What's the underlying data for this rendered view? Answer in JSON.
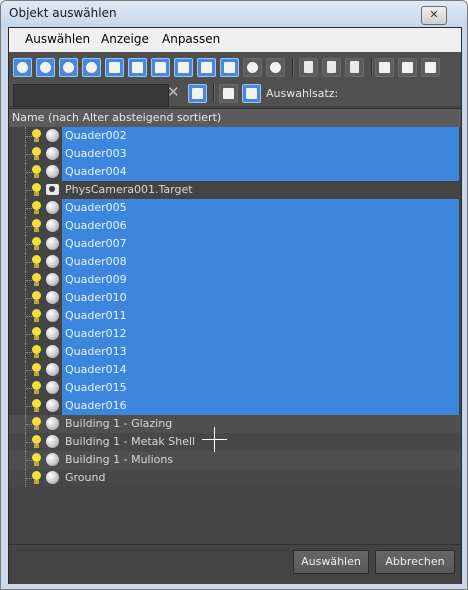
{
  "window": {
    "title": "Objekt auswählen",
    "close_glyph": "✕"
  },
  "menu": [
    "Auswählen",
    "Anzeige",
    "Anpassen"
  ],
  "toolbar": {
    "buttons": [
      {
        "name": "geometry-icon",
        "on": true,
        "shape": "circle"
      },
      {
        "name": "shapes-icon",
        "on": true,
        "shape": "circle"
      },
      {
        "name": "lights-icon",
        "on": true,
        "shape": "circle"
      },
      {
        "name": "cameras-icon",
        "on": true,
        "shape": "circle"
      },
      {
        "name": "helpers-icon",
        "on": true,
        "shape": "sq"
      },
      {
        "name": "space-warps-icon",
        "on": true,
        "shape": "sq"
      },
      {
        "name": "groups-icon",
        "on": true,
        "shape": "sq"
      },
      {
        "name": "xrefs-icon",
        "on": true,
        "shape": "sq"
      },
      {
        "name": "bones-icon",
        "on": true,
        "shape": "sq"
      },
      {
        "name": "containers-icon",
        "on": true,
        "shape": "sq"
      },
      {
        "name": "frozen-objects-icon",
        "on": false,
        "shape": "circle"
      },
      {
        "name": "hidden-objects-icon",
        "on": false,
        "shape": "circle"
      },
      {
        "name": "select-all-icon",
        "on": false,
        "shape": "doc"
      },
      {
        "name": "select-none-icon",
        "on": false,
        "shape": "doc"
      },
      {
        "name": "select-invert-icon",
        "on": false,
        "shape": "doc"
      },
      {
        "name": "filter-icon",
        "on": false,
        "shape": "sq"
      },
      {
        "name": "filter-list-icon",
        "on": false,
        "shape": "sq"
      },
      {
        "name": "display-options-icon",
        "on": false,
        "shape": "sq"
      }
    ],
    "search_value": "",
    "clear_glyph": "✕",
    "selection_set_label": "Auswahlsatz:"
  },
  "list": {
    "header": "Name (nach Alter absteigend sortiert)",
    "items": [
      {
        "name": "Quader002",
        "selected": true,
        "type": "geometry"
      },
      {
        "name": "Quader003",
        "selected": true,
        "type": "geometry"
      },
      {
        "name": "Quader004",
        "selected": true,
        "type": "geometry"
      },
      {
        "name": "PhysCamera001.Target",
        "selected": false,
        "type": "camera"
      },
      {
        "name": "Quader005",
        "selected": true,
        "type": "geometry"
      },
      {
        "name": "Quader006",
        "selected": true,
        "type": "geometry"
      },
      {
        "name": "Quader007",
        "selected": true,
        "type": "geometry"
      },
      {
        "name": "Quader008",
        "selected": true,
        "type": "geometry"
      },
      {
        "name": "Quader009",
        "selected": true,
        "type": "geometry"
      },
      {
        "name": "Quader010",
        "selected": true,
        "type": "geometry"
      },
      {
        "name": "Quader011",
        "selected": true,
        "type": "geometry"
      },
      {
        "name": "Quader012",
        "selected": true,
        "type": "geometry"
      },
      {
        "name": "Quader013",
        "selected": true,
        "type": "geometry"
      },
      {
        "name": "Quader014",
        "selected": true,
        "type": "geometry"
      },
      {
        "name": "Quader015",
        "selected": true,
        "type": "geometry"
      },
      {
        "name": "Quader016",
        "selected": true,
        "type": "geometry"
      },
      {
        "name": "Building 1 - Glazing",
        "selected": false,
        "type": "geometry"
      },
      {
        "name": "Building 1 - Metak Shell",
        "selected": false,
        "type": "geometry"
      },
      {
        "name": "Building 1 - Mulions",
        "selected": false,
        "type": "geometry"
      },
      {
        "name": "Ground",
        "selected": false,
        "type": "geometry"
      }
    ]
  },
  "buttons": {
    "select": "Auswählen",
    "cancel": "Abbrechen"
  },
  "colors": {
    "selection": "#3d86de",
    "panel": "#444444",
    "active_tool": "#4a88d8"
  }
}
